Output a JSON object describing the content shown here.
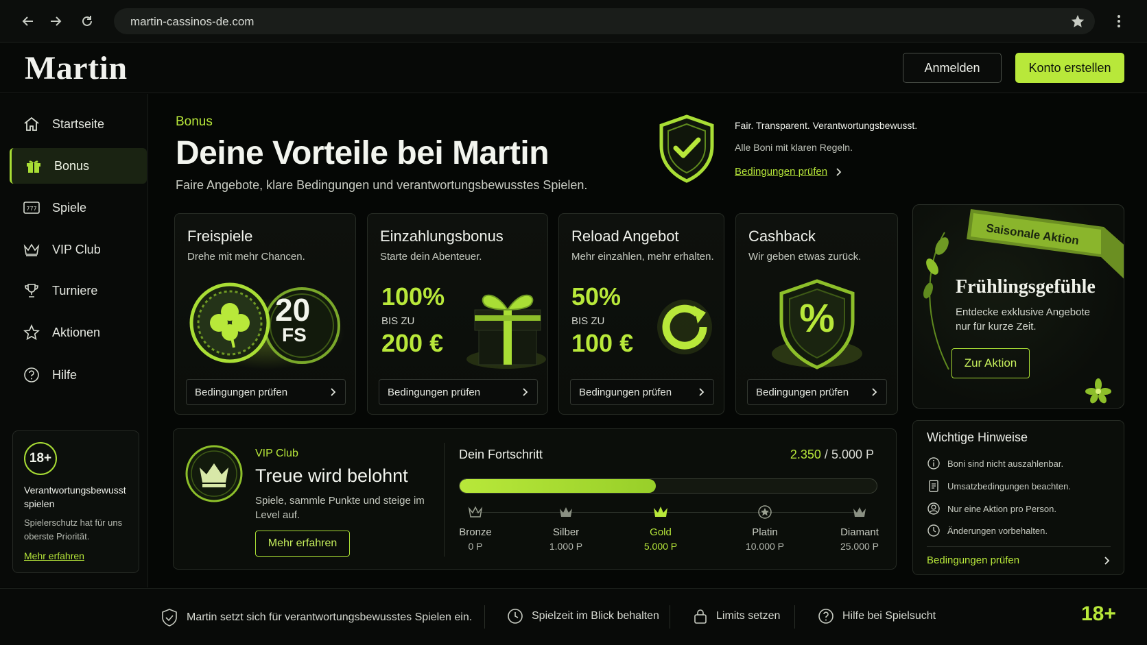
{
  "browser": {
    "url": "martin-cassinos-de.com"
  },
  "header": {
    "logo": "Martin",
    "login": "Anmelden",
    "create": "Konto erstellen"
  },
  "sidebar": {
    "items": [
      {
        "label": "Startseite",
        "icon": "home-icon"
      },
      {
        "label": "Bonus",
        "icon": "gift-icon",
        "active": true
      },
      {
        "label": "Spiele",
        "icon": "slot-777-icon"
      },
      {
        "label": "VIP Club",
        "icon": "crown-icon"
      },
      {
        "label": "Turniere",
        "icon": "trophy-icon"
      },
      {
        "label": "Aktionen",
        "icon": "star-icon"
      },
      {
        "label": "Hilfe",
        "icon": "help-icon"
      }
    ],
    "responsible": {
      "badge": "18+",
      "title": "Verantwortungsbewusst spielen",
      "text": "Spielerschutz hat für uns oberste Priorität.",
      "link": "Mehr erfahren"
    }
  },
  "hero": {
    "breadcrumb": "Bonus",
    "title": "Deine Vorteile bei Martin",
    "subtitle": "Faire Angebote, klare Bedingungen und verantwortungsbewusstes Spielen.",
    "fair_line1": "Fair. Transparent. Verantwortungsbewusst.",
    "fair_line2": "Alle Boni mit klaren Regeln.",
    "fair_link": "Bedingungen prüfen"
  },
  "cards": [
    {
      "title": "Freispiele",
      "sub": "Drehe mit mehr Chancen.",
      "big": "20",
      "small": "FS",
      "btn": "Bedingungen prüfen"
    },
    {
      "title": "Einzahlungsbonus",
      "sub": "Starte dein Abenteuer.",
      "pct": "100%",
      "bis": "BIS ZU",
      "amt": "200 €",
      "btn": "Bedingungen prüfen"
    },
    {
      "title": "Reload Angebot",
      "sub": "Mehr einzahlen, mehr erhalten.",
      "pct": "50%",
      "bis": "BIS ZU",
      "amt": "100 €",
      "btn": "Bedingungen prüfen"
    },
    {
      "title": "Cashback",
      "sub": "Wir geben etwas zurück.",
      "symbol": "%",
      "btn": "Bedingungen prüfen"
    }
  ],
  "season": {
    "ribbon": "Saisonale Aktion",
    "title": "Frühlingsgefühle",
    "text": "Entdecke exklusive Angebote nur für kurze Zeit.",
    "btn": "Zur Aktion"
  },
  "vip": {
    "label": "VIP Club",
    "title": "Treue wird belohnt",
    "text": "Spiele, sammle Punkte und steige im Level auf.",
    "btn": "Mehr erfahren",
    "progress_label": "Dein Fortschritt",
    "current": "2.350",
    "sep": " / ",
    "target": "5.000 P",
    "progress_fraction": 0.47,
    "tiers": [
      {
        "name": "Bronze",
        "points": "0 P"
      },
      {
        "name": "Silber",
        "points": "1.000 P"
      },
      {
        "name": "Gold",
        "points": "5.000 P"
      },
      {
        "name": "Platin",
        "points": "10.000 P"
      },
      {
        "name": "Diamant",
        "points": "25.000 P"
      }
    ]
  },
  "hints": {
    "title": "Wichtige Hinweise",
    "items": [
      {
        "text": "Boni sind nicht auszahlenbar.",
        "icon": "info-icon"
      },
      {
        "text": "Umsatzbedingungen beachten.",
        "icon": "document-icon"
      },
      {
        "text": "Nur eine Aktion pro Person.",
        "icon": "user-icon"
      },
      {
        "text": "Änderungen vorbehalten.",
        "icon": "clock-icon"
      }
    ],
    "link": "Bedingungen prüfen"
  },
  "footer": {
    "items": [
      {
        "text": "Martin setzt sich für verantwortungsbewusstes Spielen ein.",
        "icon": "shield-check-icon"
      },
      {
        "text": "Spielzeit im Blick behalten",
        "icon": "clock-icon"
      },
      {
        "text": "Limits setzen",
        "icon": "lock-icon"
      },
      {
        "text": "Hilfe bei Spielsucht",
        "icon": "help-icon"
      }
    ],
    "age": "18+"
  },
  "colors": {
    "accent": "#b8e83a",
    "background": "#050705"
  }
}
